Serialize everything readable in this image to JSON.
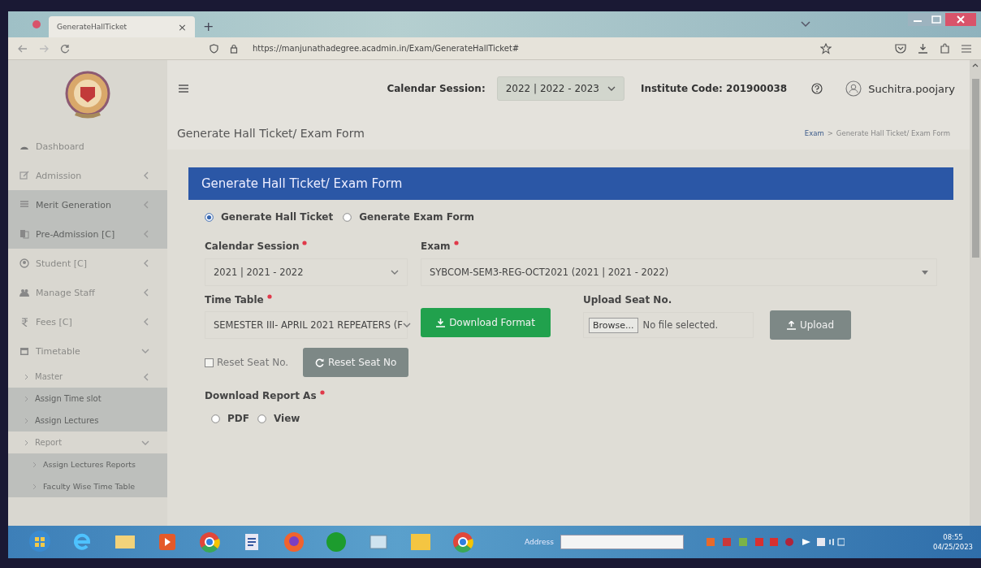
{
  "browser": {
    "tab_title": "GenerateHallTicket",
    "tab_close": "×",
    "new_tab": "+",
    "url": "https://manjunathadegree.acadmin.in/Exam/GenerateHallTicket#"
  },
  "header": {
    "calendar_label": "Calendar Session:",
    "calendar_value": "2022 | 2022 - 2023",
    "institute_code": "Institute Code: 201900038",
    "user": "Suchitra.poojary"
  },
  "sidebar": {
    "items": [
      {
        "label": "Dashboard",
        "kind": "link",
        "highlighted": false
      },
      {
        "label": "Admission",
        "kind": "menu",
        "expanded": false,
        "highlighted": false
      },
      {
        "label": "Merit Generation",
        "kind": "menu",
        "expanded": false,
        "highlighted": true
      },
      {
        "label": "Pre-Admission [C]",
        "kind": "menu",
        "expanded": false,
        "highlighted": true
      },
      {
        "label": "Student [C]",
        "kind": "menu",
        "expanded": false,
        "highlighted": false
      },
      {
        "label": "Manage Staff",
        "kind": "menu",
        "expanded": false,
        "highlighted": false
      },
      {
        "label": "Fees [C]",
        "kind": "menu",
        "expanded": false,
        "highlighted": false
      },
      {
        "label": "Timetable",
        "kind": "menu",
        "expanded": true,
        "highlighted": false,
        "children": [
          {
            "label": "Master",
            "kind": "menu",
            "expanded": false,
            "highlighted": false
          },
          {
            "label": "Assign Time slot",
            "kind": "link",
            "highlighted": true
          },
          {
            "label": "Assign Lectures",
            "kind": "link",
            "highlighted": true
          },
          {
            "label": "Report",
            "kind": "menu",
            "expanded": true,
            "highlighted": false,
            "children": [
              {
                "label": "Assign Lectures Reports",
                "kind": "link",
                "highlighted": true
              },
              {
                "label": "Faculty Wise Time Table",
                "kind": "link",
                "highlighted": true
              }
            ]
          }
        ]
      }
    ]
  },
  "page": {
    "title": "Generate Hall Ticket/ Exam Form",
    "breadcrumb": {
      "link": "Exam",
      "separator": ">",
      "current": "Generate Hall Ticket/ Exam Form"
    }
  },
  "card": {
    "title": "Generate Hall Ticket/ Exam Form",
    "modes": [
      {
        "label": "Generate Hall Ticket",
        "selected": true
      },
      {
        "label": "Generate Exam Form",
        "selected": false
      }
    ],
    "calendar_session": {
      "label": "Calendar Session",
      "required": true,
      "value": "2021 | 2021 - 2022"
    },
    "exam": {
      "label": "Exam",
      "required": true,
      "value": "SYBCOM-SEM3-REG-OCT2021 (2021 | 2021 - 2022)"
    },
    "time_table": {
      "label": "Time Table",
      "required": true,
      "value": "SEMESTER III- APRIL 2021 REPEATERS (F"
    },
    "download_format": "Download Format",
    "upload_label": "Upload Seat No.",
    "browse": "Browse...",
    "file_status": "No file selected.",
    "upload": "Upload",
    "reset_checkbox": {
      "label": "Reset Seat No.",
      "checked": false
    },
    "reset_button": "Reset Seat No",
    "report": {
      "label": "Download Report As",
      "required": true,
      "formats": [
        {
          "label": "PDF",
          "selected": false
        },
        {
          "label": "View",
          "selected": false
        }
      ]
    }
  },
  "taskbar": {
    "address_label": "Address",
    "time": "08:55",
    "date": "04/25/2023"
  }
}
